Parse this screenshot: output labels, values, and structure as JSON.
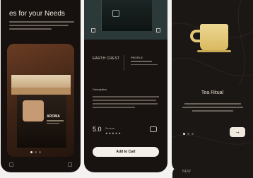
{
  "screen1": {
    "title": "es for your Needs",
    "product_label": "AROMA"
  },
  "screen2": {
    "product_name": "EARTH CREST",
    "meta_title": "PROFILE",
    "section_title": "Description",
    "rating": "5.0",
    "rating_label": "Reviews",
    "stars": "★★★★★",
    "cart_button": "Add to Cart"
  },
  "screen3": {
    "title": "Tea Ritual",
    "next_arrow": "→"
  },
  "screen4": {
    "label": "NEW"
  },
  "colors": {
    "background": "#16110e",
    "accent_gold": "#e2c779",
    "card_brown": "#6a3c23",
    "button_light": "#f4efe9"
  },
  "icons": [
    "search-icon",
    "cup-icon",
    "arrow-right-icon",
    "cart-icon",
    "star-icon"
  ]
}
